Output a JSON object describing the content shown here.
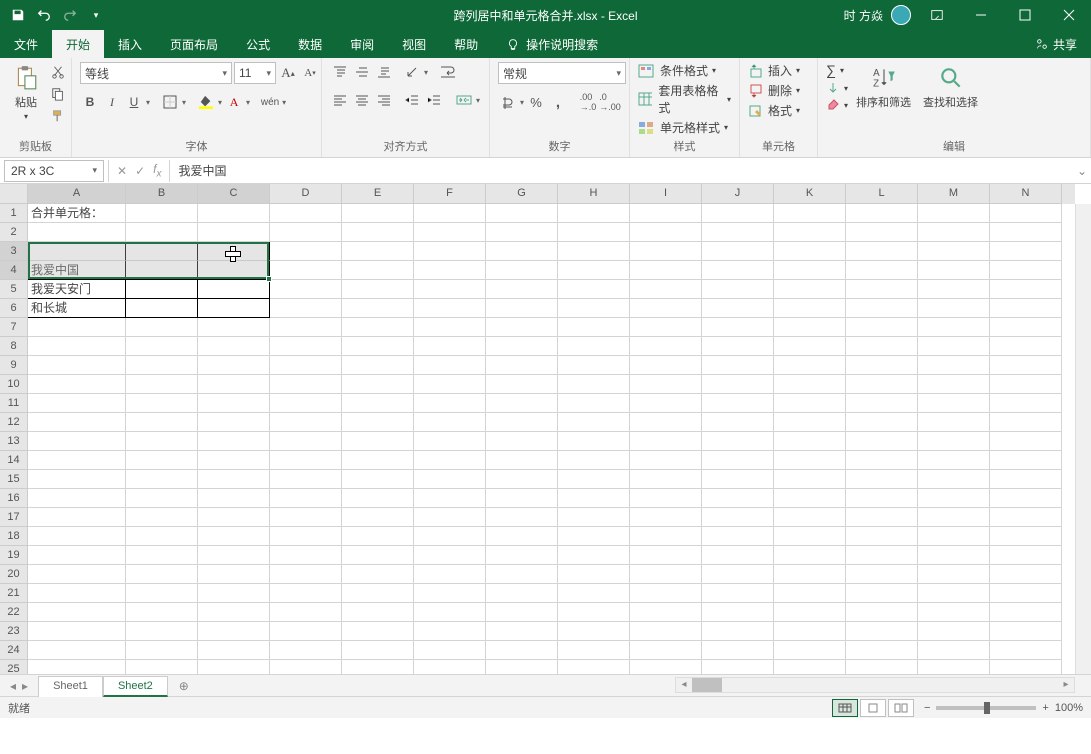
{
  "title": {
    "doc": "跨列居中和单元格合并.xlsx",
    "app": "Excel",
    "sep": " - ",
    "user": "时 方焱"
  },
  "tabs": {
    "items": [
      "文件",
      "开始",
      "插入",
      "页面布局",
      "公式",
      "数据",
      "审阅",
      "视图",
      "帮助"
    ],
    "search": "操作说明搜索",
    "share": "共享"
  },
  "ribbon": {
    "clipboard": {
      "label": "剪贴板",
      "paste": "粘贴"
    },
    "font": {
      "label": "字体",
      "name": "等线",
      "size": "11",
      "bold": "B",
      "italic": "I",
      "underline": "U"
    },
    "align": {
      "label": "对齐方式"
    },
    "number": {
      "label": "数字",
      "format": "常规"
    },
    "styles": {
      "label": "样式",
      "cond": "条件格式",
      "table": "套用表格格式",
      "cell": "单元格样式"
    },
    "cells": {
      "label": "单元格",
      "ins": "插入",
      "del": "删除",
      "fmt": "格式"
    },
    "edit": {
      "label": "编辑",
      "sort": "排序和筛选",
      "find": "查找和选择"
    }
  },
  "formula": {
    "namebox": "2R x 3C",
    "value": "我爱中国"
  },
  "grid": {
    "cols": [
      "A",
      "B",
      "C",
      "D",
      "E",
      "F",
      "G",
      "H",
      "I",
      "J",
      "K",
      "L",
      "M",
      "N"
    ],
    "widths": [
      98,
      72,
      72,
      72,
      72,
      72,
      72,
      72,
      72,
      72,
      72,
      72,
      72,
      72
    ],
    "rows": 25,
    "data": {
      "A1": "合并单元格：",
      "A4": "我爱中国",
      "A5": "我爱天安门",
      "A6": "和长城"
    },
    "borderbox": {
      "r1": 3,
      "c1": 0,
      "r2": 6,
      "c2": 2
    },
    "selection": {
      "r1": 3,
      "c1": 0,
      "r2": 4,
      "c2": 2
    },
    "activeRow": 3
  },
  "sheets": {
    "items": [
      "Sheet1",
      "Sheet2"
    ],
    "active": 1
  },
  "status": {
    "ready": "就绪",
    "zoom": "100%"
  }
}
